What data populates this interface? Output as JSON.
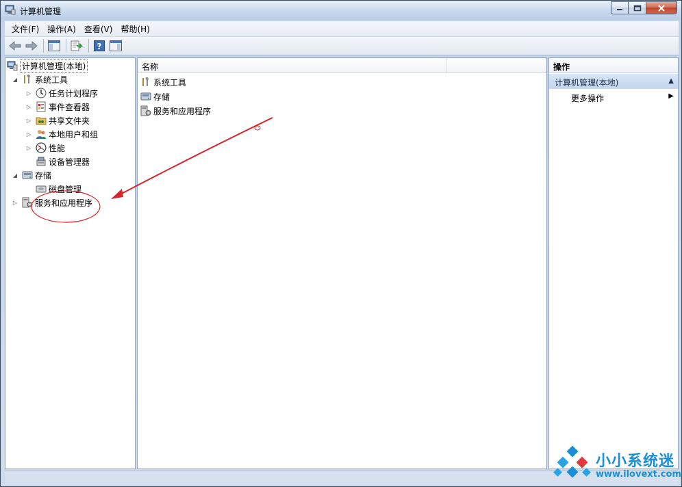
{
  "window": {
    "title": "计算机管理"
  },
  "menubar": {
    "items": [
      "文件(F)",
      "操作(A)",
      "查看(V)",
      "帮助(H)"
    ]
  },
  "tree": {
    "root": "计算机管理(本地)",
    "items": [
      {
        "label": "系统工具",
        "level": 1,
        "expanded": true,
        "icon": "tools-icon"
      },
      {
        "label": "任务计划程序",
        "level": 2,
        "expanded": false,
        "icon": "clock-icon"
      },
      {
        "label": "事件查看器",
        "level": 2,
        "expanded": false,
        "icon": "event-viewer-icon"
      },
      {
        "label": "共享文件夹",
        "level": 2,
        "expanded": false,
        "icon": "shared-folder-icon"
      },
      {
        "label": "本地用户和组",
        "level": 2,
        "expanded": false,
        "icon": "users-icon"
      },
      {
        "label": "性能",
        "level": 2,
        "expanded": false,
        "icon": "performance-icon"
      },
      {
        "label": "设备管理器",
        "level": 2,
        "expanded": null,
        "icon": "device-manager-icon"
      },
      {
        "label": "存储",
        "level": 1,
        "expanded": true,
        "icon": "storage-icon"
      },
      {
        "label": "磁盘管理",
        "level": 2,
        "expanded": null,
        "icon": "disk-icon"
      },
      {
        "label": "服务和应用程序",
        "level": 1,
        "expanded": false,
        "icon": "services-icon"
      }
    ]
  },
  "list": {
    "column_name": "名称",
    "rows": [
      "系统工具",
      "存储",
      "服务和应用程序"
    ]
  },
  "actions": {
    "title": "操作",
    "section": "计算机管理(本地)",
    "more": "更多操作"
  },
  "watermark": {
    "brand": "小小系统迷",
    "url": "www.ilovext.com"
  },
  "colors": {
    "annotation": "#d8262b",
    "brand": "#1a8fd8"
  }
}
